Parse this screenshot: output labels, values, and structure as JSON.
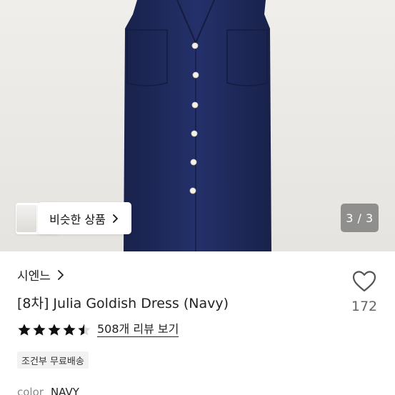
{
  "gallery": {
    "similar_label": "비슷한 상품",
    "counter": "3 / 3",
    "dress_color": "#1e2a57",
    "button_color": "#f7f2e8",
    "background_color": "#ecebe8"
  },
  "product": {
    "brand": "시엔느",
    "title": "[8차] Julia Goldish Dress (Navy)",
    "rating": 4.5,
    "review_link": "508개 리뷰 보기",
    "shipping_badge": "조건부 무료배송",
    "color_label": "color",
    "color_value": "NAVY"
  },
  "like": {
    "count": "172",
    "icon": "heart-outline-icon"
  }
}
